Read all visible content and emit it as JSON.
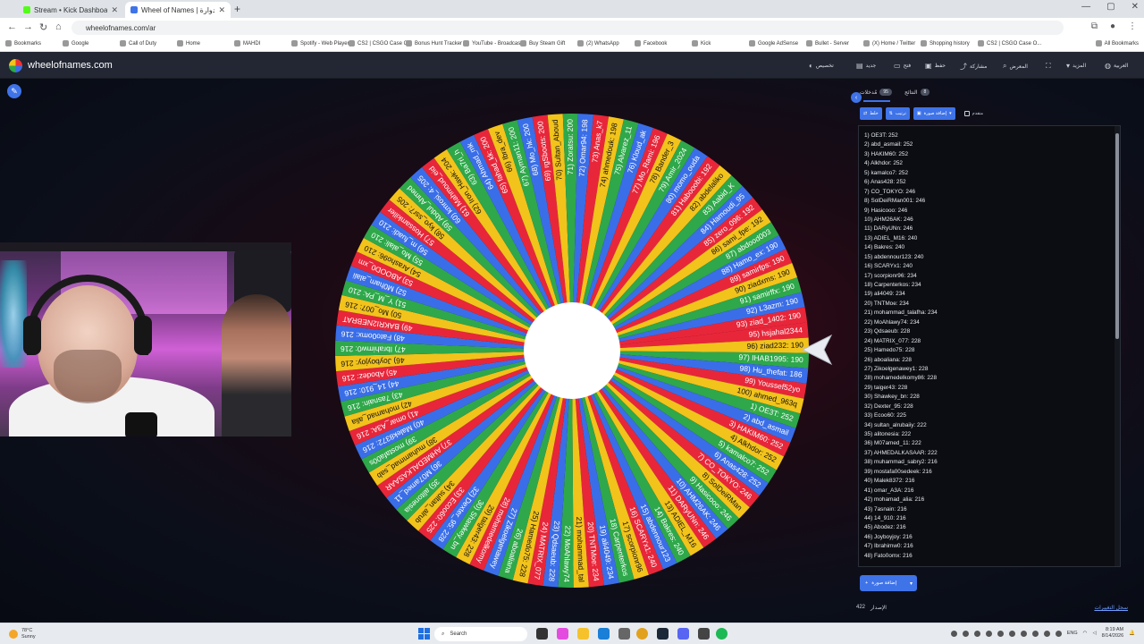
{
  "browser": {
    "tabs": [
      {
        "title": "Stream • Kick Dashboard",
        "active": false,
        "favicon_color": "#53fc18"
      },
      {
        "title": "Wheel of Names | العجلة الدوارة",
        "active": true,
        "favicon_color": "#3f73e8"
      }
    ],
    "url": "wheelofnames.com/ar",
    "bookmarks": [
      "Bookmarks",
      "Google",
      "Call of Duty",
      "Home",
      "MAHDI",
      "Spotify - Web Player",
      "CS2 | CSGO Case O...",
      "Bonus Hunt Tracker",
      "YouTube - Broadcast...",
      "Buy Steam Gift",
      "(2) WhatsApp",
      "Facebook",
      "Kick",
      "Google AdSense",
      "Bullet - Server",
      "(X) Home / Twitter",
      "Shopping history",
      "CS2 | CSGO Case O...",
      "All Bookmarks"
    ]
  },
  "app": {
    "site_name": "wheelofnames.com",
    "menu": [
      {
        "label": "تخصيص",
        "icon": "palette-icon"
      },
      {
        "label": "جديد",
        "icon": "file-icon"
      },
      {
        "label": "فتح",
        "icon": "folder-icon"
      },
      {
        "label": "حفظ",
        "icon": "save-icon"
      },
      {
        "label": "مشاركة",
        "icon": "share-icon"
      },
      {
        "label": "المعرض",
        "icon": "search-icon"
      },
      {
        "label": "",
        "icon": "fullscreen-icon"
      },
      {
        "label": "المزيد",
        "icon": "chevron-down-icon"
      },
      {
        "label": "العربية",
        "icon": "globe-icon"
      }
    ]
  },
  "sidebar": {
    "tabs": [
      {
        "label": "مُدخلات",
        "badge": "95"
      },
      {
        "label": "النتائج",
        "badge": "8"
      }
    ],
    "tools": {
      "shuffle": "خلط",
      "sort": "ترتيب",
      "add_image": "إضافة صورة",
      "advanced": "متقدم"
    },
    "add_button": "إضافة صورة",
    "version_label": "الإصدار",
    "version": "422",
    "changelog": "سجل التغييرات"
  },
  "entries": [
    "1) OE3T: 252",
    "2) abd_asmail: 252",
    "3) HAKIM60: 252",
    "4) Alkhdor: 252",
    "5) kamalco7: 252",
    "6) Anas428: 252",
    "7) CO_TOKYO: 246",
    "8) SolDeiRMan001: 246",
    "9) Hasicooo: 246",
    "10) AHM26AK: 246",
    "11) DARyUNn: 246",
    "13) ADIEL_M16: 240",
    "14) Bakres: 240",
    "15) abdennour123: 240",
    "16) SCARYx1: 240",
    "17) scorpionr96: 234",
    "18) Carpenterkos: 234",
    "19) ali4049: 234",
    "20) TNTMoe: 234",
    "21) mohammad_talafha: 234",
    "22) MoAhlawy74: 234",
    "23) Qdsaeub: 228",
    "24) MATRIX_077: 228",
    "25) Hamedo75: 228",
    "26) aboaliana: 228",
    "27) Zikoelgenawey1: 228",
    "28) mohamedelkomy86: 228",
    "29) taiger43: 228",
    "30) Shawkey_bn: 228",
    "32) Dexter_95: 228",
    "33) Ecoo60: 225",
    "34) sultan_alrubaiiy: 222",
    "35) alitonesia: 222",
    "36) M07amed_11: 222",
    "37) AHMEDALKASAAR: 222",
    "38) muhammad_sabry2: 216",
    "39) mostafa00sedeek: 216",
    "40) Malek8372: 216",
    "41) omar_A3A: 216",
    "42) mohamad_alia: 216",
    "43) 7asnain: 216",
    "44) 14_910: 216",
    "45) Abodez: 216",
    "46) Joyboyjoy: 216",
    "47) Ibrahimw0: 216",
    "48) Fato0omx: 216"
  ],
  "wheel": {
    "colors": [
      "#e8263a",
      "#f2c31b",
      "#2ea84a",
      "#3a6ee8"
    ],
    "slices": [
      "95) hsjahal2344",
      "96) ziad232: 190",
      "97) IHAB1995: 190",
      "98) Hu_thefat: 186",
      "99) Youssef52yo",
      "100) ahmed_963q",
      "1) OE3T: 252",
      "2) abd_asmail",
      "3) HAKIM60: 252",
      "4) Alkhdor: 252",
      "5) kamalco7: 252",
      "6) Anas428: 252",
      "7) CO_TOKYO: 246",
      "8) SolDeiRMan",
      "9) Hasicooo: 246",
      "10) AHM26AK: 246",
      "11) DARyUNn: 246",
      "13) ADIEL_M16",
      "14) Bakres: 240",
      "15) abdennour123",
      "16) SCARYx1: 240",
      "17) scorpionr96",
      "18) Carpenterkos",
      "19) ali4049: 234",
      "20) TNTMoe: 234",
      "21) mohammad_tal",
      "22) MoAhlawy74",
      "23) Qdsaeub: 228",
      "24) MATRIX_077",
      "25) Hamedo75: 228",
      "26) aboaliana",
      "27) Zikoelgenawey",
      "28) mohamedelkomy",
      "29) taiger43: 228",
      "30) Shawkey_bn",
      "32) Dexter_95: 228",
      "33) Ecoo60: 225",
      "34) sultan_alrub",
      "35) alitonesia",
      "36) M07amed_11",
      "37) AHMEDALKASAAR",
      "38) muhammad_sab",
      "39) mostafa00s",
      "40) Malek8372: 216",
      "41) omar_A3A: 216",
      "42) mohamad_alia",
      "43) 7asnain: 216",
      "44) 14_910: 216",
      "45) Abodez: 216",
      "46) Joyboyjoy: 216",
      "47) Ibrahimw0: 216",
      "48) Fato0omx: 216",
      "49) BAKRI2NEBRAT",
      "50) Mo_007: 216",
      "51) Y_M_PA: 210",
      "52) M0ham_alali",
      "53) ABOOD0_xm",
      "54) Arasho96: 210",
      "55) Mo_alali: 210",
      "56) m_fuadi: 210",
      "57) Hossamkiller",
      "58) kyo_ssr7: 205",
      "59) Abdul_Ahmed",
      "60) kmrosi_4: 205",
      "61) Mahmoud_eid",
      "62) Iron_Hawk: 204",
      "63) Ba7ri_h",
      "64) Ahmad_mk",
      "65) fahad_kk: 200",
      "66) Ibra_dev",
      "67) Ayman11: 200",
      "68) Mo_hk: 200",
      "69) rgSboots: 200",
      "70) Sultan_Aboud",
      "71) Zoratsu: 200",
      "72) Omar94: 198",
      "73) Anas_k7",
      "74) ahmedouk: 198",
      "75) Alvarez_11",
      "76) Kloud_ak",
      "77) Mo_Rami: 196",
      "78) Bander_3",
      "79) Amir_2024",
      "80) momo_ouda",
      "81) Habooobi: 192",
      "82) abdelaliko",
      "83) Aabid_K",
      "84) Hamoudi_95",
      "85) zero_096: 192",
      "86) sami_fpe: 192",
      "87) abdood003",
      "88) Hamo_ex: 190",
      "89) samirfps: 190",
      "90) ziadxms: 190",
      "91) samirffx: 190",
      "92) L3azm: 190",
      "93) ziad_1402: 190"
    ]
  },
  "taskbar": {
    "weather_temp": "78°C",
    "weather_desc": "Sunny",
    "search_label": "Search",
    "lang": "ENG",
    "time": "8:19 AM",
    "date": "8/14/2026"
  }
}
